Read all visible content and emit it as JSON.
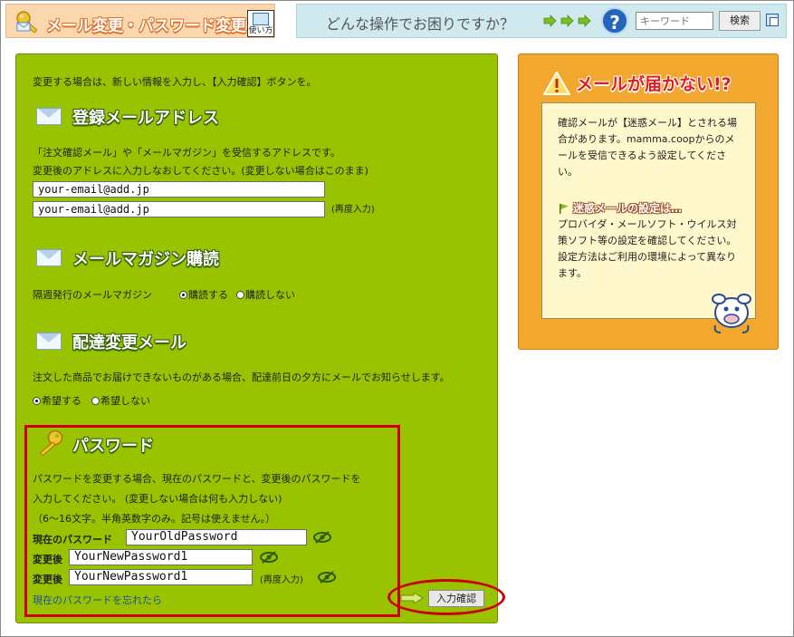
{
  "header": {
    "title": "メール変更・パスワード変更",
    "howto_label": "使い方",
    "question": "どんな操作でお困りですか？",
    "help_symbol": "?",
    "search_placeholder": "キーワード",
    "search_button": "検索"
  },
  "intro": "変更する場合は、新しい情報を入力し、【入力確認】ボタンを。",
  "email_section": {
    "title": "登録メールアドレス",
    "desc1": "「注文確認メール」や「メールマガジン」を受信するアドレスです。",
    "desc2": "変更後のアドレスに入力しなおしてください。(変更しない場合はこのまま)",
    "email": "your-email@add.jp",
    "email_confirm": "your-email@add.jp",
    "confirm_note": "(再度入力)"
  },
  "magazine_section": {
    "title": "メールマガジン購読",
    "label": "隔週発行のメールマガジン",
    "options": [
      "購読する",
      "購読しない"
    ],
    "selected": 0
  },
  "delivery_section": {
    "title": "配達変更メール",
    "desc": "注文した商品でお届けできないものがある場合、配達前日の夕方にメールでお知らせします。",
    "options": [
      "希望する",
      "希望しない"
    ],
    "selected": 0
  },
  "password_section": {
    "title": "パスワード",
    "desc1": "パスワードを変更する場合、現在のパスワードと、変更後のパスワードを",
    "desc2": "入力してください。 (変更しない場合は何も入力しない)",
    "rule": "（6～16文字。半角英数字のみ。記号は使えません。）",
    "current_label": "現在のパスワード",
    "current_value": "YourOldPassword",
    "new_label": "変更後",
    "new_value": "YourNewPassword1",
    "new_confirm_label": "変更後",
    "new_confirm_value": "YourNewPassword1",
    "confirm_note": "(再度入力)",
    "forgot_link": "現在のパスワードを忘れたら"
  },
  "submit_button": "入力確認",
  "side": {
    "title": "メールが届かない!?",
    "para1": "確認メールが【迷惑メール】とされる場合があります。mamma.coopからのメールを受信できるよう設定してください。",
    "subheading": "迷惑メールの設定は…",
    "para2": "プロバイダ・メールソフト・ウイルス対策ソフト等の設定を確認してください。 設定方法はご利用の環境によって異なります。"
  },
  "colors": {
    "main_panel": "#99c300",
    "side_panel": "#f2a72e",
    "highlight": "#cc0000",
    "header_left": "#fbd7ae",
    "header_right": "#cfe9ef"
  }
}
